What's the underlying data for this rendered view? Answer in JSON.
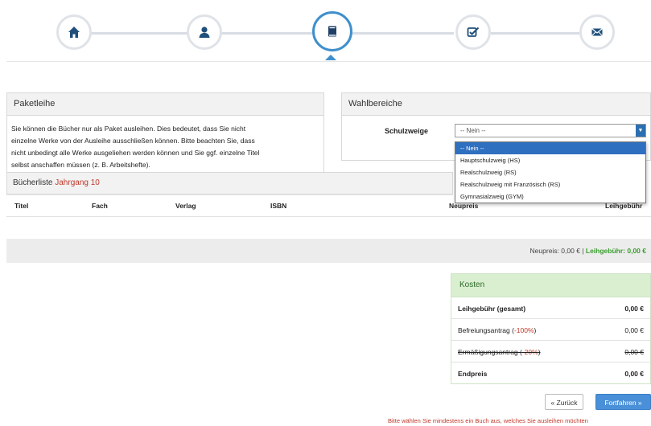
{
  "wizard": {
    "steps": [
      {
        "icon": "home-icon"
      },
      {
        "icon": "user-icon"
      },
      {
        "icon": "book-icon",
        "active": true
      },
      {
        "icon": "checklist-icon"
      },
      {
        "icon": "envelope-icon"
      }
    ],
    "accent": "#3f8fcc"
  },
  "paket": {
    "title": "Paketleihe",
    "text_line1": "Sie können die Bücher nur als Paket ausleihen. Dies bedeutet, dass Sie nicht",
    "text_line2": "einzelne Werke von der Ausleihe ausschließen können. Bitte beachten Sie, dass",
    "text_line3": "nicht unbedingt alle Werke ausgeliehen werden können und Sie ggf. einzelne Titel",
    "text_line4": "selbst anschaffen müssen (z. B. Arbeitshefte)."
  },
  "wahl": {
    "title": "Wahlbereiche",
    "label": "Schulzweige",
    "selected": "-- Nein --",
    "options": [
      "-- Nein --",
      "Hauptschulzweig (HS)",
      "Realschulzweig (RS)",
      "Realschulzweig mit Französisch (RS)",
      "Gymnasialzweig (GYM)"
    ]
  },
  "books": {
    "title": "Bücherliste",
    "grade": "Jahrgang 10",
    "columns": {
      "titel": "Titel",
      "fach": "Fach",
      "verlag": "Verlag",
      "isbn": "ISBN",
      "neupreis": "Neupreis",
      "leihgebuehr": "Leihgebühr"
    },
    "summary_neupreis": "Neupreis: 0,00 €",
    "summary_sep": "|",
    "summary_leih": "Leihgebühr: 0,00 €"
  },
  "kosten": {
    "title": "Kosten",
    "rows": {
      "leih_label": "Leihgebühr (gesamt)",
      "leih_value": "0,00 €",
      "befreiung_label": "Befreiungsantrag (",
      "befreiung_pct": "-100%",
      "befreiung_close": ")",
      "befreiung_value": "0,00 €",
      "ermaessigung_label": "Ermäßigungsantrag (",
      "ermaessigung_pct": "-20%",
      "ermaessigung_close": ")",
      "ermaessigung_value": "0,00 €",
      "end_label": "Endpreis",
      "end_value": "0,00 €"
    }
  },
  "buttons": {
    "back": "« Zurück",
    "next": "Fortfahren »"
  },
  "warning": "Bitte wählen Sie mindestens ein Buch aus, welches Sie ausleihen möchten"
}
